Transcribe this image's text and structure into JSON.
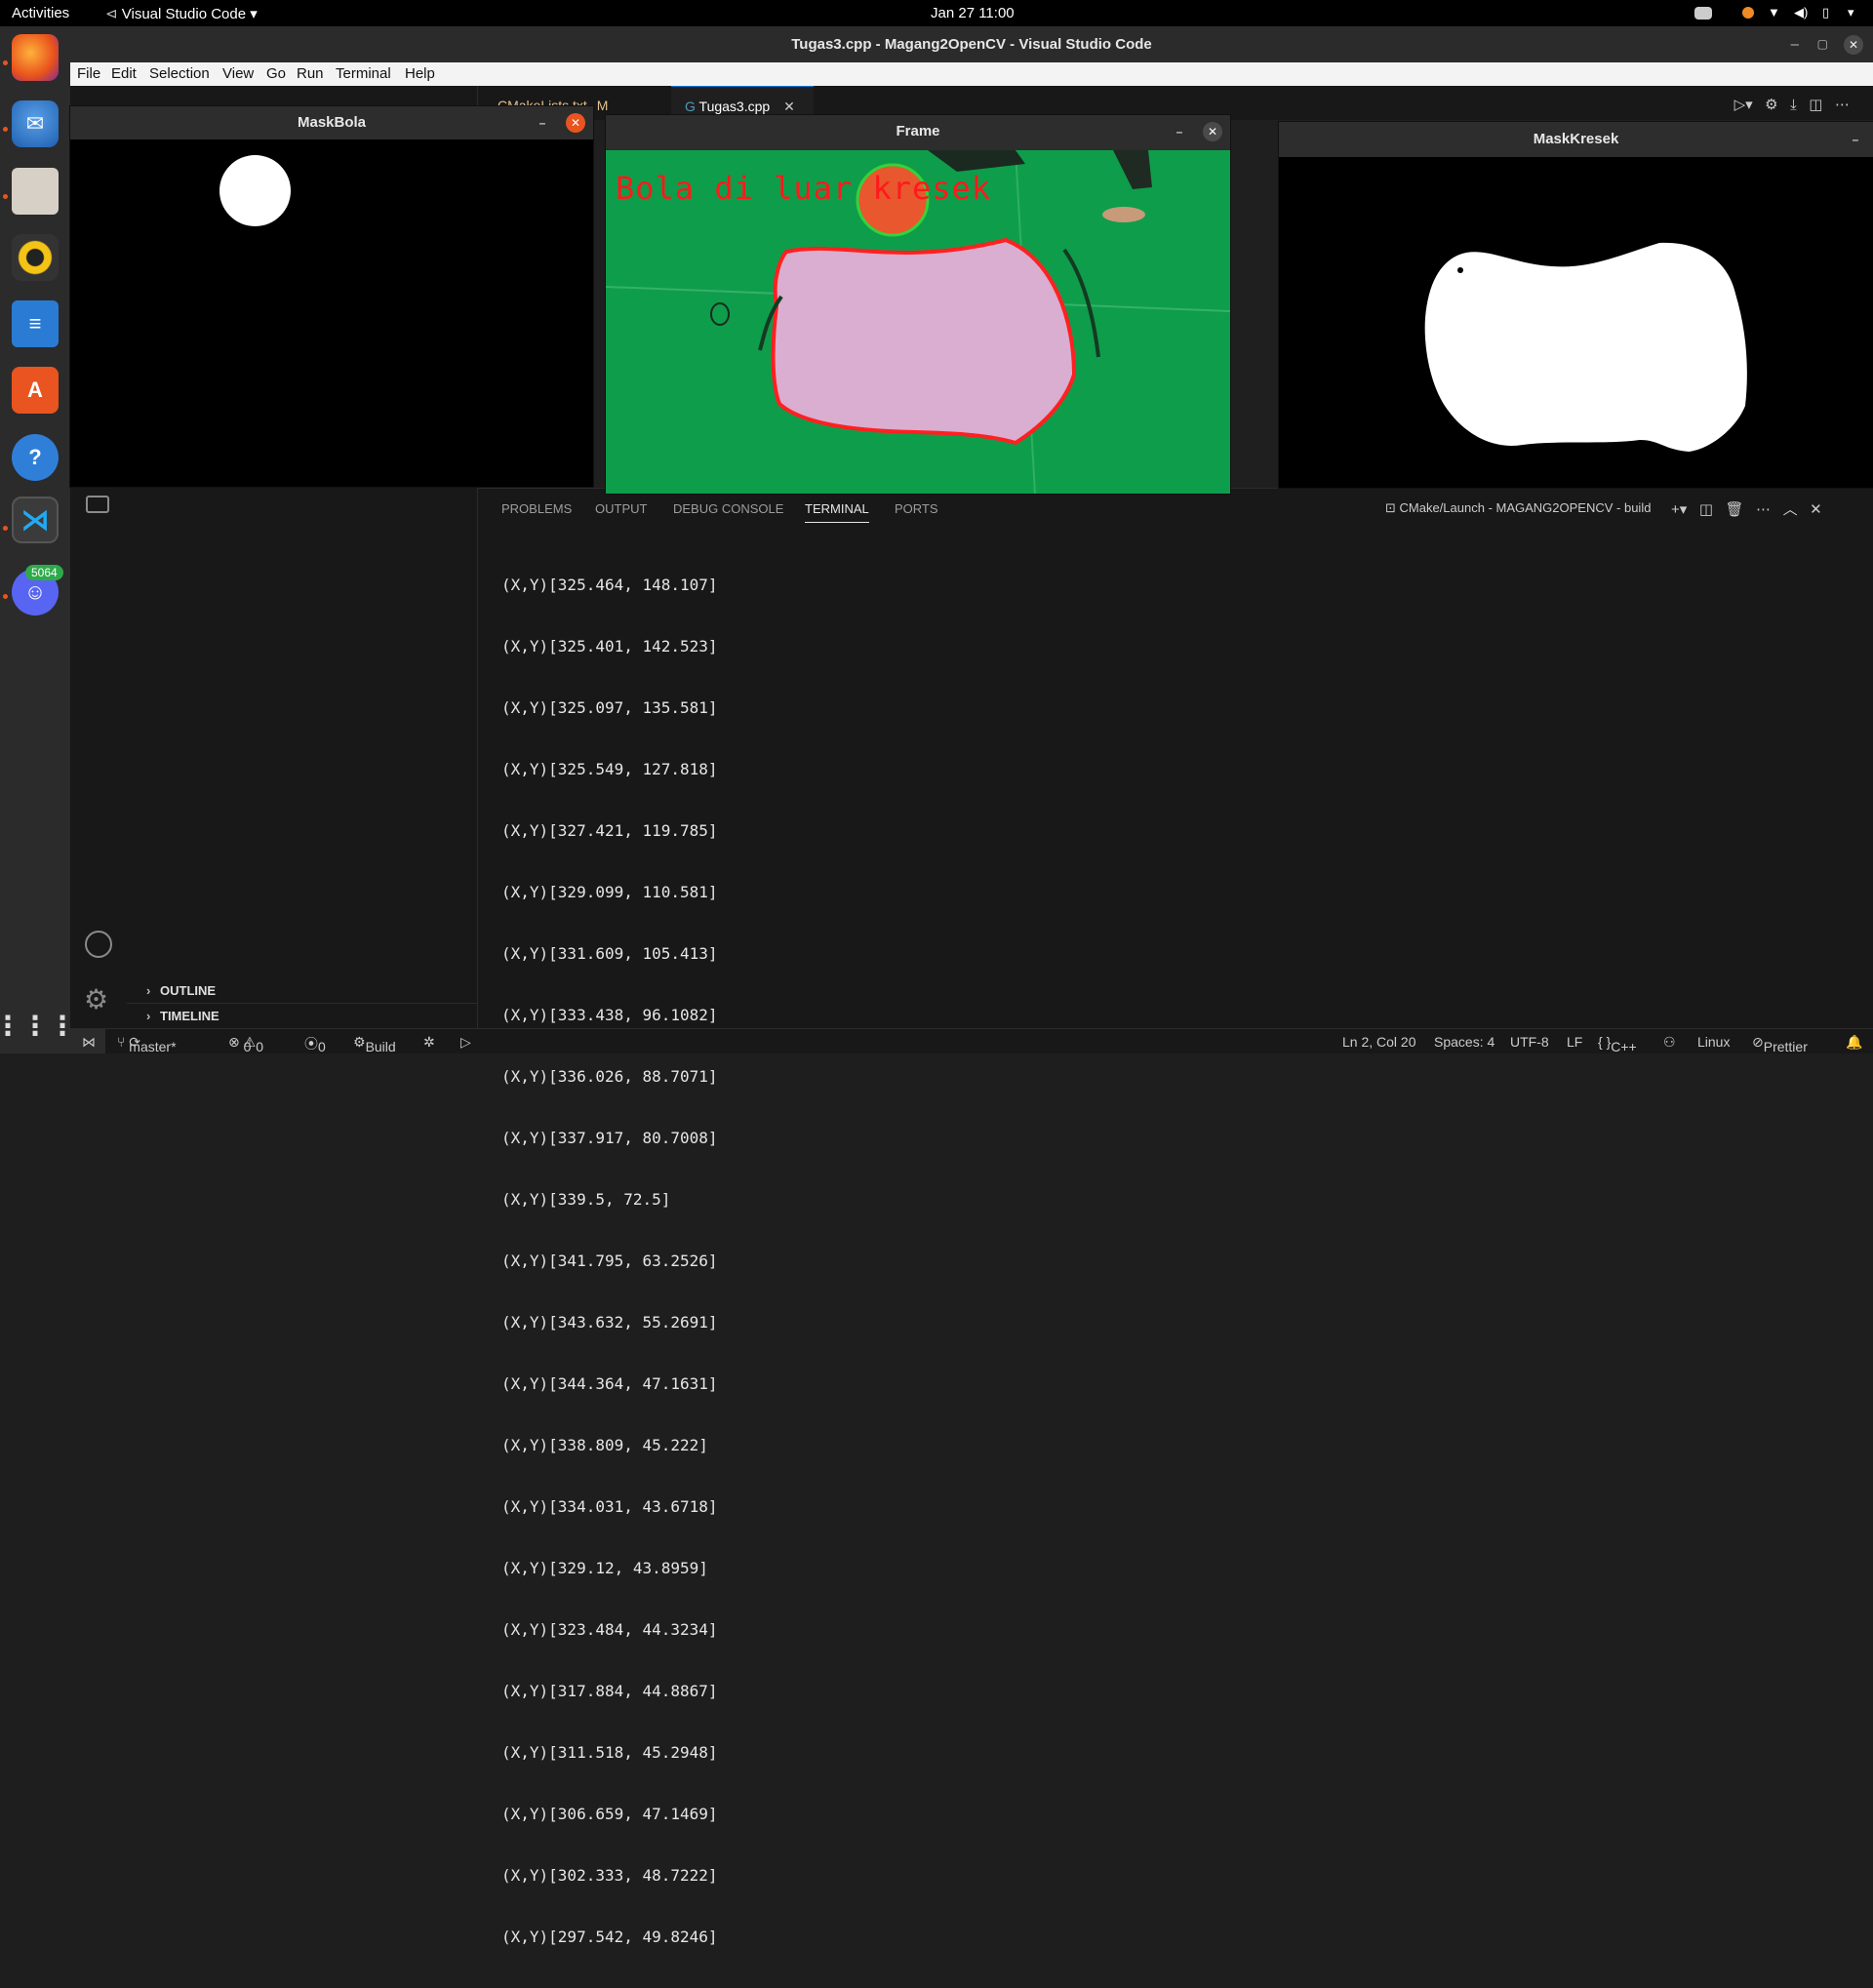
{
  "topbar": {
    "activities": "Activities",
    "app_name": "Visual Studio Code",
    "clock": "Jan 27  11:00"
  },
  "dock": {
    "badge_count": "5064"
  },
  "window": {
    "title": "Tugas3.cpp - Magang2OpenCV - Visual Studio Code"
  },
  "menu": [
    "File",
    "Edit",
    "Selection",
    "View",
    "Go",
    "Run",
    "Terminal",
    "Help"
  ],
  "editor_tabs": {
    "tab1": "CMakeLists.txt",
    "tab1_badge": "M",
    "tab2": "Tugas3.cpp"
  },
  "sidebar": {
    "outline": "OUTLINE",
    "timeline": "TIMELINE"
  },
  "panel": {
    "tabs": [
      "PROBLEMS",
      "OUTPUT",
      "DEBUG CONSOLE",
      "TERMINAL",
      "PORTS"
    ],
    "active_tab": "TERMINAL",
    "terminal_name": "CMake/Launch - MAGANG2OPENCV - build",
    "lines": [
      "(X,Y)[325.464, 148.107]",
      "(X,Y)[325.401, 142.523]",
      "(X,Y)[325.097, 135.581]",
      "(X,Y)[325.549, 127.818]",
      "(X,Y)[327.421, 119.785]",
      "(X,Y)[329.099, 110.581]",
      "(X,Y)[331.609, 105.413]",
      "(X,Y)[333.438, 96.1082]",
      "(X,Y)[336.026, 88.7071]",
      "(X,Y)[337.917, 80.7008]",
      "(X,Y)[339.5, 72.5]",
      "(X,Y)[341.795, 63.2526]",
      "(X,Y)[343.632, 55.2691]",
      "(X,Y)[344.364, 47.1631]",
      "(X,Y)[338.809, 45.222]",
      "(X,Y)[334.031, 43.6718]",
      "(X,Y)[329.12, 43.8959]",
      "(X,Y)[323.484, 44.3234]",
      "(X,Y)[317.884, 44.8867]",
      "(X,Y)[311.518, 45.2948]",
      "(X,Y)[306.659, 47.1469]",
      "(X,Y)[302.333, 48.7222]",
      "(X,Y)[297.542, 49.8246]"
    ]
  },
  "cv_windows": {
    "maskbola": "MaskBola",
    "frame": "Frame",
    "frame_overlay_text": "Bola di luar kresek",
    "maskkresek": "MaskKresek"
  },
  "statusbar": {
    "branch": "master*",
    "errors": "0",
    "warnings": "0",
    "ports": "0",
    "build": "Build",
    "position": "Ln 2, Col 20",
    "spaces": "Spaces: 4",
    "encoding": "UTF-8",
    "eol": "LF",
    "language": "C++",
    "platform": "Linux",
    "prettier": "Prettier"
  },
  "colors": {
    "accent": "#0078d4",
    "ubuntu_orange": "#e95420",
    "frame_text": "#ff1a1a",
    "kresek_outline": "#ff2020",
    "ball_circle": "#36d13a"
  }
}
